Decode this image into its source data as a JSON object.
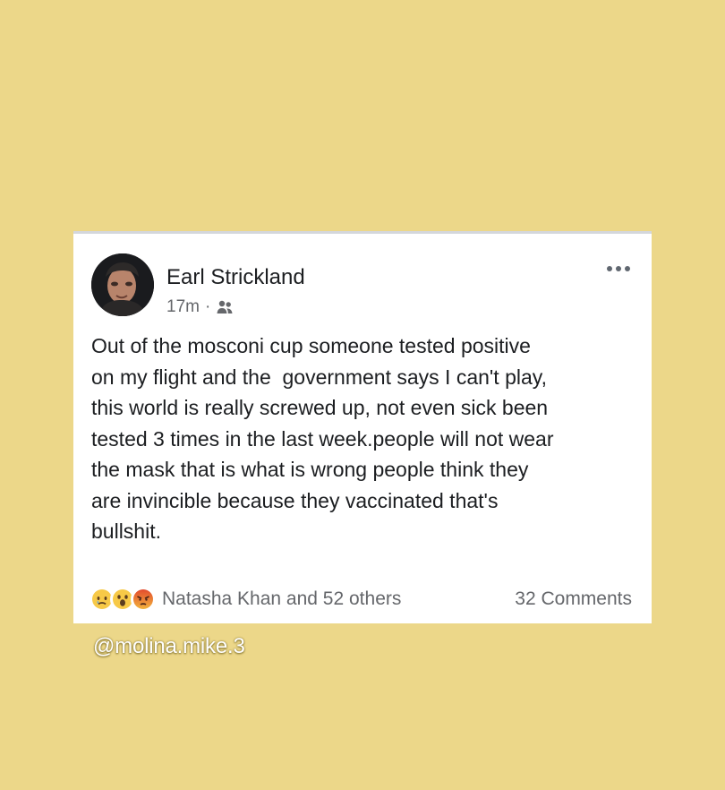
{
  "post": {
    "author": "Earl Strickland",
    "time": "17m",
    "meta_separator": "·",
    "audience_icon": "friends-icon",
    "more_icon": "more-options-icon",
    "text": "Out of the mosconi cup someone tested positive\non my flight and the  government says I can't play,\nthis world is really screwed up, not even sick been\ntested 3 times in the last week.people will not wear\nthe mask that is what is wrong people think they\nare invincible because they vaccinated that's\nbullshit.",
    "reactions": {
      "icons": [
        "sad-reaction-icon",
        "wow-reaction-icon",
        "angry-reaction-icon"
      ],
      "names": "Natasha Khan and 52 others"
    },
    "comments": "32 Comments"
  },
  "watermark": "@molina.mike.3",
  "colors": {
    "background": "#ecd789",
    "card": "#ffffff",
    "text": "#1c1e21",
    "secondary_text": "#65676b"
  }
}
